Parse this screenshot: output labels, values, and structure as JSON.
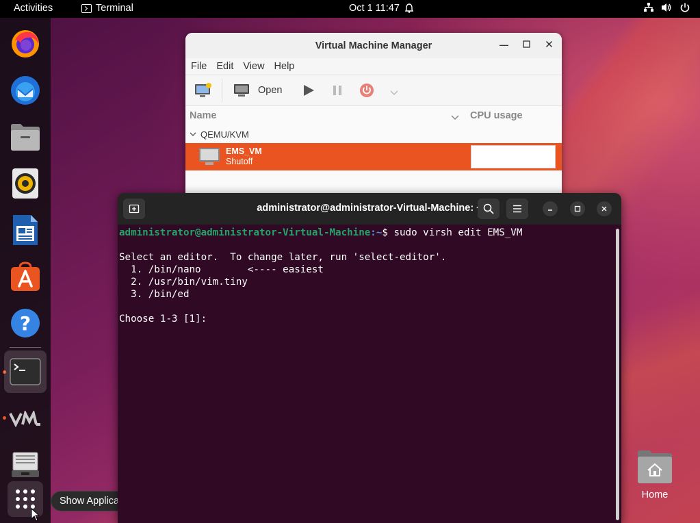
{
  "topbar": {
    "activities": "Activities",
    "app_name": "Terminal",
    "clock": "Oct 1  11:47"
  },
  "dock": {
    "items": [
      {
        "name": "firefox",
        "icon": "firefox-icon"
      },
      {
        "name": "thunderbird",
        "icon": "thunderbird-icon"
      },
      {
        "name": "files",
        "icon": "files-icon"
      },
      {
        "name": "rhythmbox",
        "icon": "rhythmbox-icon"
      },
      {
        "name": "libreoffice-writer",
        "icon": "writer-icon"
      },
      {
        "name": "ubuntu-software",
        "icon": "software-icon"
      },
      {
        "name": "help",
        "icon": "help-icon"
      },
      {
        "name": "terminal",
        "icon": "terminal-icon",
        "active": true
      },
      {
        "name": "virt-manager",
        "icon": "vmm-icon",
        "running": true
      },
      {
        "name": "disk-manager",
        "icon": "disk-icon"
      },
      {
        "name": "show-applications",
        "icon": "grid-icon"
      }
    ],
    "tooltip": "Show Applications"
  },
  "desktop": {
    "home_label": "Home"
  },
  "vmm": {
    "title": "Virtual Machine Manager",
    "menu": [
      "File",
      "Edit",
      "View",
      "Help"
    ],
    "toolbar": {
      "open_label": "Open"
    },
    "columns": {
      "name": "Name",
      "cpu": "CPU usage"
    },
    "group": "QEMU/KVM",
    "vm": {
      "name": "EMS_VM",
      "status": "Shutoff"
    }
  },
  "terminal": {
    "title": "administrator@administrator-Virtual-Machine: ~",
    "prompt_user": "administrator@administrator-Virtual-Machine",
    "prompt_path": ":~",
    "command": "$ sudo virsh edit EMS_VM",
    "lines": [
      "",
      "Select an editor.  To change later, run 'select-editor'.",
      "  1. /bin/nano        <---- easiest",
      "  2. /usr/bin/vim.tiny",
      "  3. /bin/ed",
      "",
      "Choose 1-3 [1]: "
    ]
  },
  "colors": {
    "ubuntu_orange": "#e95420",
    "terminal_bg": "#300a24",
    "prompt_green": "#26a269"
  }
}
